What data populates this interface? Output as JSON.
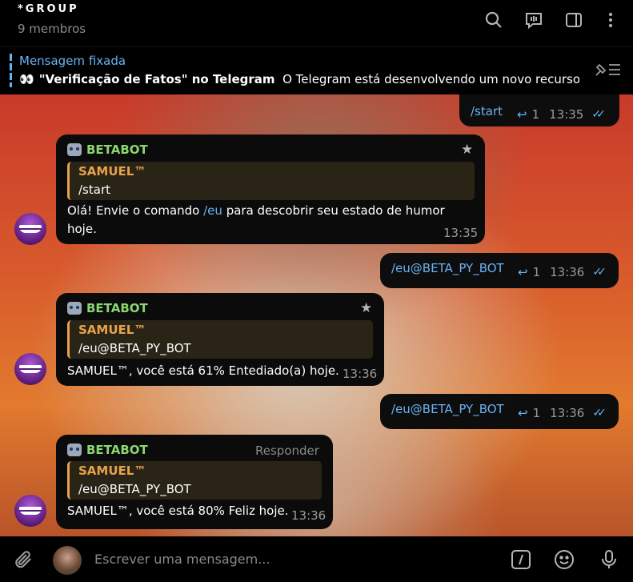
{
  "header": {
    "title": "*GROUP",
    "subtitle": "9 membros",
    "icons": [
      "search-icon",
      "video-chat-icon",
      "sidebar-toggle-icon",
      "more-vertical-icon"
    ]
  },
  "pinned": {
    "label": "Mensagem fixada",
    "emoji": "👀",
    "bold": "\"Verificação de Fatos\" no Telegram",
    "text": "O Telegram está desenvolvendo um novo recurso…"
  },
  "messages": [
    {
      "type": "outgoing",
      "text": "/start",
      "reply_count": "1",
      "time": "13:35"
    },
    {
      "type": "incoming",
      "sender": "BETABOT",
      "quote_name": "SAMUEL™",
      "quote_text": "/start",
      "text_before": "Olá! Envie o comando ",
      "text_link": "/eu",
      "text_after": " para descobrir seu estado de humor",
      "text_line2": "hoje.",
      "time": "13:35"
    },
    {
      "type": "outgoing",
      "text": "/eu@BETA_PY_BOT",
      "reply_count": "1",
      "time": "13:36"
    },
    {
      "type": "incoming",
      "sender": "BETABOT",
      "quote_name": "SAMUEL™",
      "quote_text": "/eu@BETA_PY_BOT",
      "text": "SAMUEL™, você está 61% Entediado(a) hoje.",
      "time": "13:36"
    },
    {
      "type": "outgoing",
      "text": "/eu@BETA_PY_BOT",
      "reply_count": "1",
      "time": "13:36"
    },
    {
      "type": "incoming",
      "sender": "BETABOT",
      "action": "Responder",
      "quote_name": "SAMUEL™",
      "quote_text": "/eu@BETA_PY_BOT",
      "text": "SAMUEL™, você está 80% Feliz hoje.",
      "time": "13:36"
    }
  ],
  "composer": {
    "placeholder": "Escrever uma mensagem...",
    "icons": [
      "attach-icon",
      "bot-commands-icon",
      "emoji-icon",
      "microphone-icon"
    ]
  },
  "colors": {
    "accent": "#6ab3f3",
    "bot_name": "#8bd66f",
    "quote_name": "#e8a24b",
    "bubble_bg": "#0b0b0b"
  }
}
